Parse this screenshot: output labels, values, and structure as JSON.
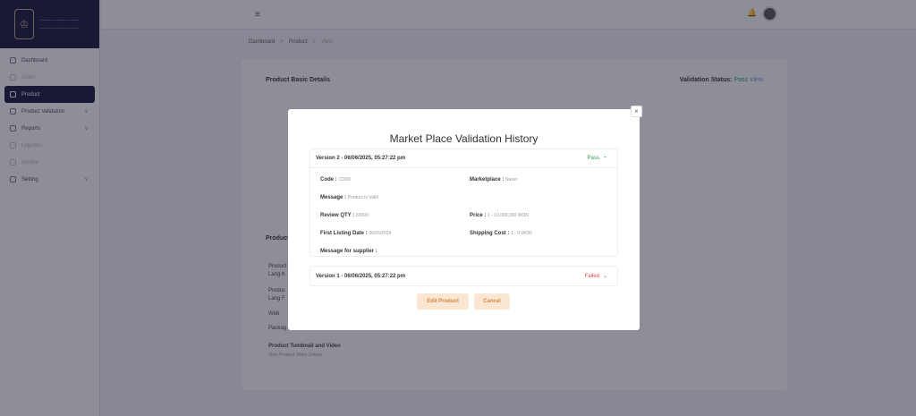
{
  "sidebar": {
    "items": [
      {
        "label": "Dashboard",
        "state": "normal"
      },
      {
        "label": "Users",
        "state": "dim"
      },
      {
        "label": "Product",
        "state": "active"
      },
      {
        "label": "Product Validation",
        "state": "normal",
        "chevron": "v"
      },
      {
        "label": "Reports",
        "state": "normal",
        "chevron": "v"
      },
      {
        "label": "Logistics",
        "state": "dim"
      },
      {
        "label": "Invoice",
        "state": "dim"
      },
      {
        "label": "Setting",
        "state": "normal",
        "chevron": "v"
      }
    ]
  },
  "topbar": {
    "menu_icon": "≡",
    "bell_icon": "🔔"
  },
  "breadcrumb": {
    "home": "Dashboard",
    "section": "Product",
    "current": "View",
    "sep": ">"
  },
  "background": {
    "title": "Product Basic Details",
    "status_label": "Validation Status:",
    "status_value": "Pass",
    "view_link": "View",
    "section2": "Product",
    "rows": [
      "Product",
      "Lang K",
      "Produc",
      "Lang F",
      "Web",
      "Packag"
    ],
    "bottom_label": "Product Tumbnail and Video",
    "bottom_sub": "View Product Video Details"
  },
  "modal": {
    "title": "Market Place Validation History",
    "close": "×",
    "versions": [
      {
        "label": "Version 2 - 06/06/2025, 05:27:22 pm",
        "status": "Pass",
        "chevron": "⌃",
        "expanded": true,
        "fields": {
          "code_label": "Code :",
          "code_value": "C0001",
          "marketplace_label": "Marketplace :",
          "marketplace_value": "Naver",
          "message_label": "Message :",
          "message_value": "Product is Valid",
          "review_label": "Review QTY :",
          "review_value": "60000",
          "price_label": "Price :",
          "price_value": "1 - 10,000,000 WON",
          "first_listing_label": "First Listing Date :",
          "first_listing_value": "06/05/2024",
          "shipping_label": "Shipping Cost :",
          "shipping_value": "1 - 0 WON",
          "supplier_label": "Message for supplier :",
          "supplier_value": ""
        }
      },
      {
        "label": "Version 1 - 06/06/2025, 05:27:22 pm",
        "status": "Failed",
        "chevron": "⌄",
        "expanded": false
      }
    ],
    "edit_button": "Edit Product",
    "cancel_button": "Cancel"
  },
  "colors": {
    "brand_navy": "#14143a",
    "pass": "#2e9b5a",
    "fail": "#d84545",
    "button_bg": "#fbe7d1"
  }
}
